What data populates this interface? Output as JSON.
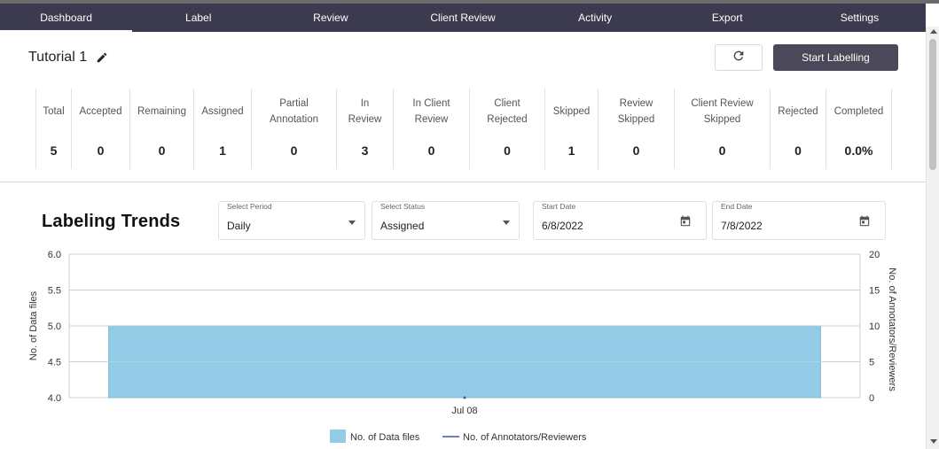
{
  "nav": {
    "items": [
      {
        "label": "Dashboard",
        "active": true
      },
      {
        "label": "Label"
      },
      {
        "label": "Review"
      },
      {
        "label": "Client Review"
      },
      {
        "label": "Activity"
      },
      {
        "label": "Export"
      },
      {
        "label": "Settings"
      }
    ]
  },
  "project": {
    "title": "Tutorial 1",
    "edit_icon": "pencil-icon",
    "refresh_icon": "refresh-icon",
    "start_button": "Start Labelling"
  },
  "stats": [
    {
      "label": "Total",
      "value": "5"
    },
    {
      "label": "Accepted",
      "value": "0"
    },
    {
      "label": "Remaining",
      "value": "0"
    },
    {
      "label": "Assigned",
      "value": "1"
    },
    {
      "label": "Partial Annotation",
      "value": "0"
    },
    {
      "label": "In Review",
      "value": "3"
    },
    {
      "label": "In Client Review",
      "value": "0"
    },
    {
      "label": "Client Rejected",
      "value": "0"
    },
    {
      "label": "Skipped",
      "value": "1"
    },
    {
      "label": "Review Skipped",
      "value": "0"
    },
    {
      "label": "Client Review Skipped",
      "value": "0"
    },
    {
      "label": "Rejected",
      "value": "0"
    },
    {
      "label": "Completed",
      "value": "0.0%"
    }
  ],
  "trends": {
    "title": "Labeling Trends",
    "period": {
      "label": "Select Period",
      "value": "Daily"
    },
    "status": {
      "label": "Select Status",
      "value": "Assigned"
    },
    "start_date": {
      "label": "Start Date",
      "value": "6/8/2022"
    },
    "end_date": {
      "label": "End Date",
      "value": "7/8/2022"
    }
  },
  "colors": {
    "nav_bg": "#3b3a4e",
    "bar_fill": "#94cbe6",
    "bar_stroke": "#7fb7d6",
    "line_color": "#4457a8"
  },
  "chart_data": {
    "type": "bar",
    "categories": [
      "Jul 08"
    ],
    "series": [
      {
        "name": "No. of Data files",
        "axis": "left",
        "type": "bar",
        "values": [
          5.0
        ]
      },
      {
        "name": "No. of Annotators/Reviewers",
        "axis": "right",
        "type": "line",
        "values": [
          0
        ]
      }
    ],
    "ylabel": "No. of Data files",
    "y2label": "No. of Annotators/Reviewers",
    "ylim": [
      4.0,
      6.0
    ],
    "y2lim": [
      0,
      20
    ],
    "yticks": [
      "6.0",
      "5.5",
      "5.0",
      "4.5",
      "4.0"
    ],
    "y2ticks": [
      "20",
      "15",
      "10",
      "5",
      "0"
    ],
    "grid": true,
    "legend": "bottom"
  }
}
